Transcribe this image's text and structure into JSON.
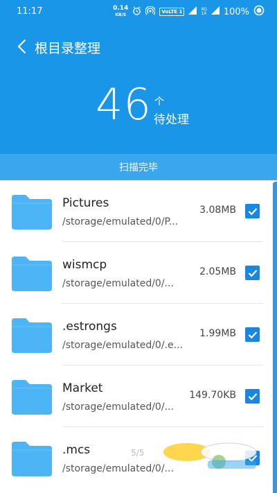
{
  "status": {
    "time": "11:17",
    "net_speed_value": "0.14",
    "net_speed_unit": "KB/S",
    "volte": "VoLTE 1",
    "sig_top": "4G",
    "sig_bottom": "1X",
    "battery": "100%"
  },
  "appbar": {
    "title": "根目录整理"
  },
  "summary": {
    "count": "46",
    "unit": "个",
    "label": "待处理"
  },
  "scan": {
    "status": "扫描完毕"
  },
  "items": [
    {
      "name": "Pictures",
      "path": "/storage/emulated/0/P...",
      "size": "3.08MB",
      "checked": true
    },
    {
      "name": "wismcp",
      "path": "/storage/emulated/0/...",
      "size": "2.05MB",
      "checked": true
    },
    {
      "name": ".estrongs",
      "path": "/storage/emulated/0/.e...",
      "size": "1.99MB",
      "checked": true
    },
    {
      "name": "Market",
      "path": "/storage/emulated/0/...",
      "size": "149.70KB",
      "checked": true
    },
    {
      "name": ".mcs",
      "path": "/storage/emulated/0/...",
      "size": "",
      "checked": true
    }
  ],
  "page_indicator": "5/5",
  "colors": {
    "header": "#1a96e8",
    "scanbar": "#3aa6ee",
    "folder": "#4db5f5",
    "checkbox": "#1a86de"
  }
}
